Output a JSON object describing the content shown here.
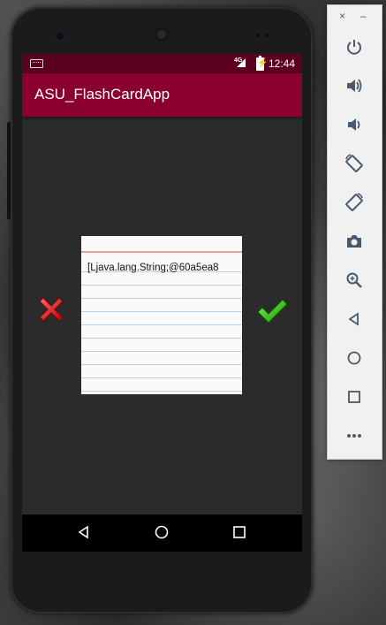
{
  "status_bar": {
    "network": "4G",
    "time": "12:44"
  },
  "app_bar": {
    "title": "ASU_FlashCardApp"
  },
  "flash_card": {
    "text": "[Ljava.lang.String;@60a5ea8"
  },
  "emulator_toolbar": {
    "close_label": "×",
    "minimize_label": "–",
    "buttons": [
      "power-icon",
      "volume-up-icon",
      "volume-down-icon",
      "rotate-left-icon",
      "rotate-right-icon",
      "camera-icon",
      "zoom-icon",
      "back-icon",
      "home-icon",
      "overview-icon",
      "more-icon"
    ]
  },
  "colors": {
    "status_bar": "#5b0020",
    "app_bar": "#8a002e",
    "screen_bg": "#2b2b2b",
    "toolbar_icon": "#4a5a6a"
  }
}
